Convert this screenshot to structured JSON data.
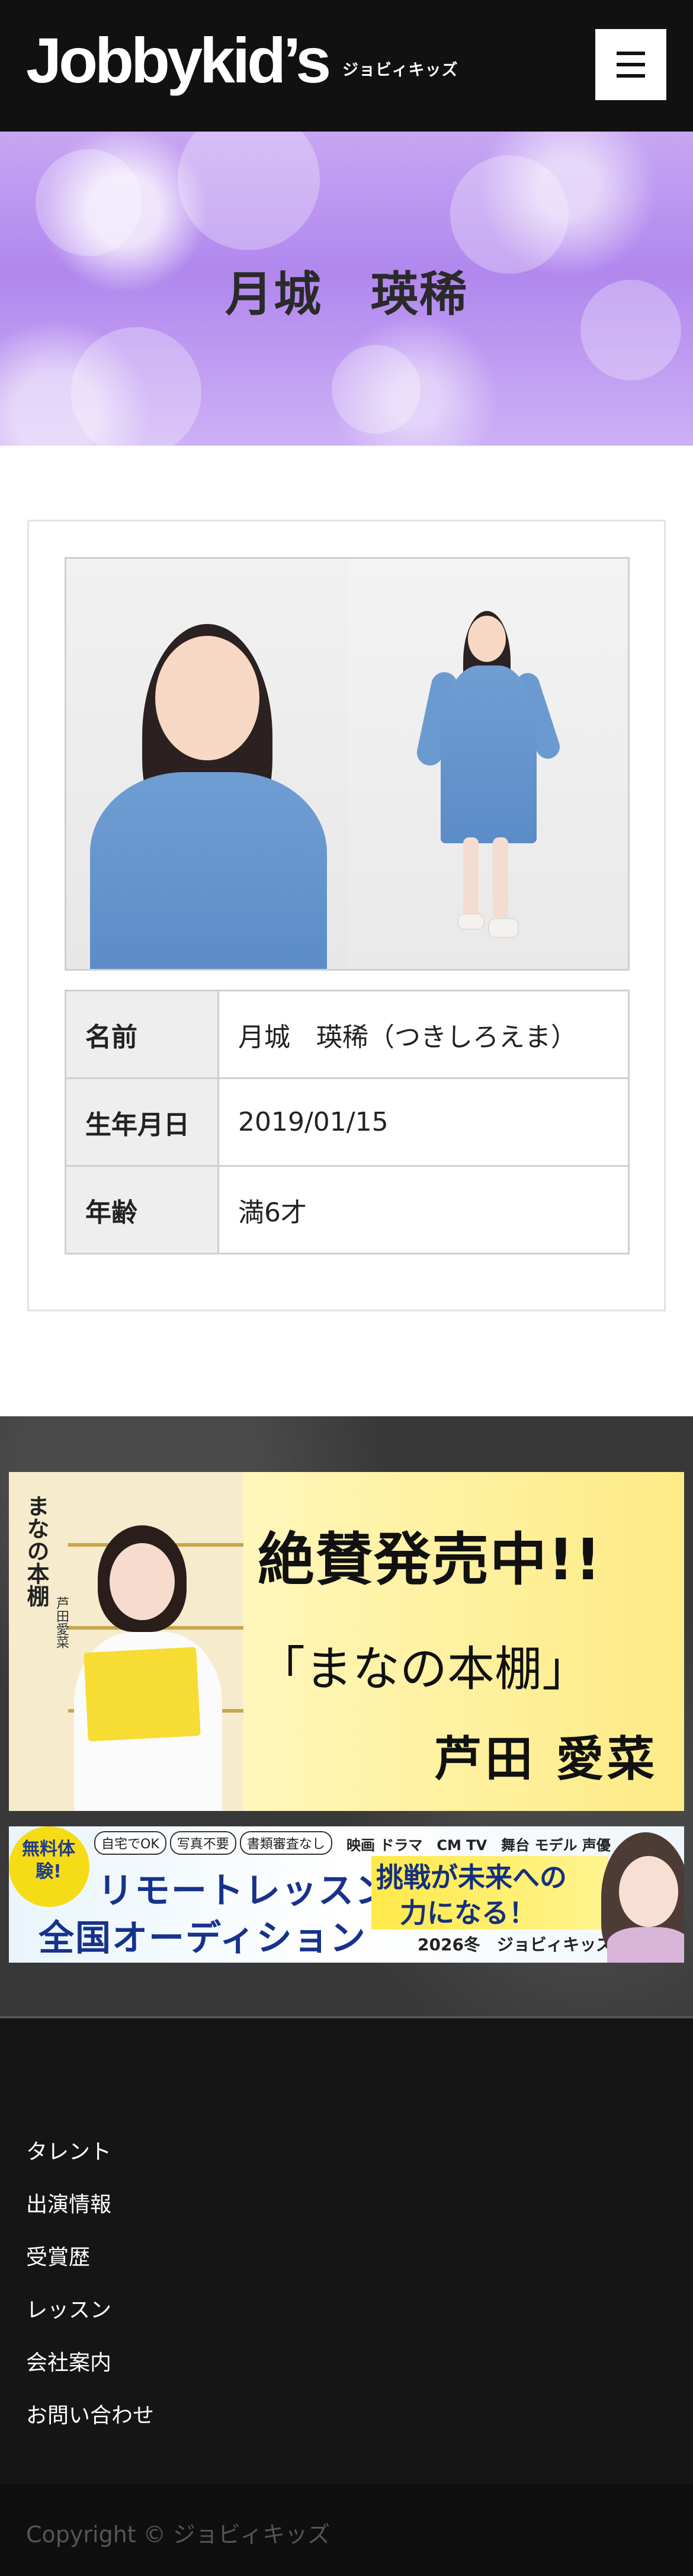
{
  "header": {
    "logo": "Jobbykid’s",
    "logo_sub": "ジョビィキッズ",
    "menu_icon": "hamburger-menu-icon"
  },
  "hero": {
    "title": "月城　瑛稀"
  },
  "profile": {
    "rows": [
      {
        "label": "名前",
        "value": "月城　瑛稀（つきしろえま）"
      },
      {
        "label": "生年月日",
        "value": "2019/01/15"
      },
      {
        "label": "年齢",
        "value": "満6才"
      }
    ]
  },
  "banners": {
    "book": {
      "book_title": "まなの本棚",
      "book_author": "芦田愛菜",
      "line1": "絶賛発売中!!",
      "line2": "「まなの本棚」",
      "line3": "芦田 愛菜"
    },
    "audition": {
      "badge": "無料体験!",
      "chips": [
        "自宅でOK",
        "写真不要",
        "書類審査なし"
      ],
      "genres": "映画 ドラマ　CM TV　舞台 モデル 声優",
      "main1": "リモートレッスン",
      "main2": "全国オーディション",
      "slogan1": "挑戦が未来への",
      "slogan2": "力になる！",
      "season": "2026冬　ジョビィキッズ"
    }
  },
  "footer": {
    "nav": [
      "タレント",
      "出演情報",
      "受賞歴",
      "レッスン",
      "会社案内",
      "お問い合わせ"
    ],
    "copyright": "Copyright © ジョビィキッズ"
  },
  "colors": {
    "header_bg": "#111111",
    "hero_purple": "#b187ee",
    "footer_bg": "#151515",
    "audition_blue": "#17328c",
    "badge_yellow": "#f6dc16"
  }
}
